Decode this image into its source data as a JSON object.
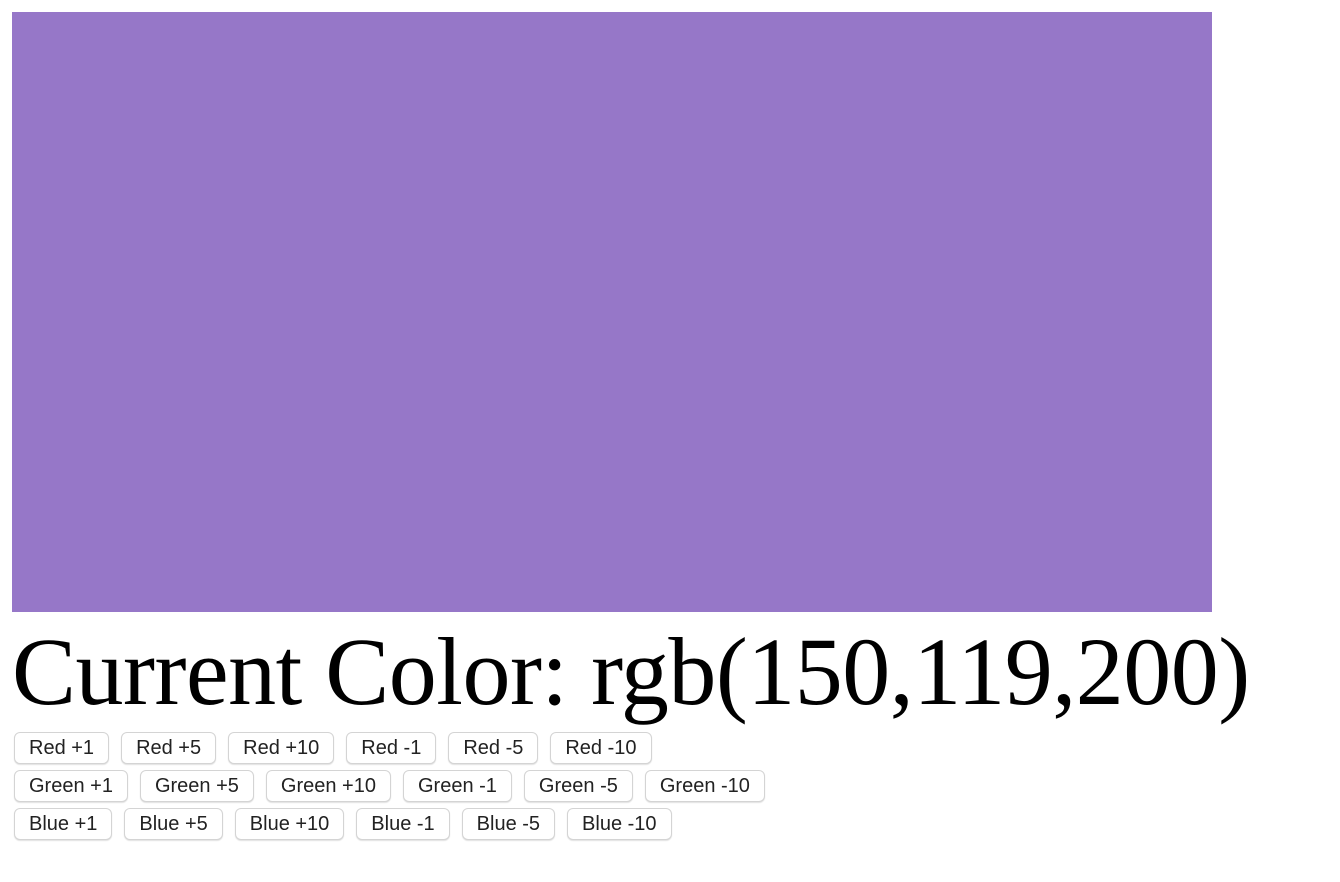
{
  "current_color": {
    "swatch_hex": "#9677c8",
    "heading_text": "Current Color: rgb(150,119,200)"
  },
  "buttons": {
    "red": [
      "Red +1",
      "Red +5",
      "Red +10",
      "Red -1",
      "Red -5",
      "Red -10"
    ],
    "green": [
      "Green +1",
      "Green +5",
      "Green +10",
      "Green -1",
      "Green -5",
      "Green -10"
    ],
    "blue": [
      "Blue +1",
      "Blue +5",
      "Blue +10",
      "Blue -1",
      "Blue -5",
      "Blue -10"
    ]
  }
}
